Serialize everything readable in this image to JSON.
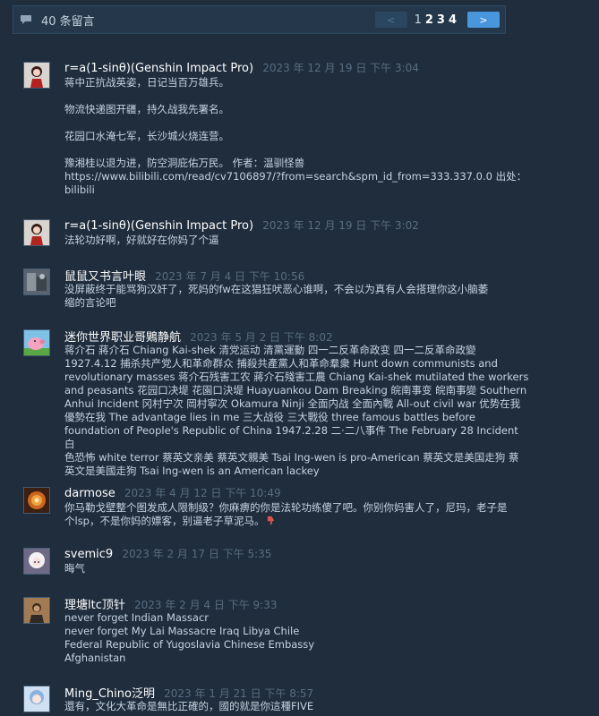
{
  "header": {
    "count_label": "40 条留言",
    "prev_label": "<",
    "next_label": ">",
    "pages": [
      "1",
      "2",
      "3",
      "4"
    ],
    "current_page": "2"
  },
  "comments": [
    {
      "author": "r=a(1-sinθ)(Genshin Impact Pro)",
      "time": "2023 年 12 月 19 日 下午 3:04",
      "avatar_icon": "anime-girl-avatar",
      "lines": [
        "蒋中正抗战英姿，日记当百万雄兵。",
        "",
        "物流快递图开疆，持久战我先署名。",
        "",
        "花园口水淹七军，长沙城火烧连营。",
        "",
        "豫湘桂以退为进，防空洞庇佑万民。 作者：温驯怪兽",
        "https://www.bilibili.com/read/cv7106897/?from=search&spm_id_from=333.337.0.0 出处：",
        "bilibili"
      ]
    },
    {
      "author": "r=a(1-sinθ)(Genshin Impact Pro)",
      "time": "2023 年 12 月 19 日 下午 3:02",
      "avatar_icon": "anime-girl-avatar",
      "lines": [
        "法轮功好啊，好就好在你妈了个逼"
      ]
    },
    {
      "author": "鼠鼠又书言叶眼",
      "time": "2023 年 7 月 4 日 下午 10:56",
      "avatar_icon": "photo-avatar",
      "lines": [
        "没屏蔽终于能骂狗汉奸了，死妈的fw在这猖狂吠恶心谁啊，不会以为真有人会搭理你这小脑萎",
        "缩的言论吧"
      ]
    },
    {
      "author": "迷你世界职业哥鶪静航",
      "time": "2023 年 5 月 2 日 下午 8:02",
      "avatar_icon": "pig-avatar",
      "lines": [
        "蒋介石 蔣介石 Chiang Kai-shek 清党运动 清黨運動 四一二反革命政变 四一二反革命政變",
        "1927.4.12 捕杀共产党人和革命群众 捕殺共產黨人和革命羣衆 Hunt down communists and",
        "revolutionary masses 蒋介石残害工农 蔣介石殘害工農 Chiang Kai-shek mutilated the workers",
        "and peasants 花园口决堤 花園口決堤 Huayuankou Dam Breaking 皖南事变 皖南事變 Southern",
        "Anhui Incident 冈村宁次 岡村寧次 Okamura Ninji 全面内战 全面內戰 All-out civil war 优势在我",
        "優勢在我 The advantage lies in me 三大战役 三大戰役 three famous battles before",
        "foundation of People's Republic of China 1947.2.28 二·二八事件 The February 28 Incident 白",
        "色恐怖 white terror 蔡英文亲美 蔡英文親美 Tsai Ing-wen is pro-American 蔡英文是美国走狗 蔡",
        "英文是美國走狗 Tsai Ing-wen is an American lackey"
      ]
    },
    {
      "author": "darmose",
      "time": "2023 年 4 月 12 日 下午 10:49",
      "avatar_icon": "orange-avatar",
      "lines": [
        "你马勒戈壁整个图发成人限制级？你麻痹的你是法轮功练傻了吧。你别你妈害人了，尼玛，老子是",
        "个lsp，不是你妈的嫖客，别逼老子草泥马。"
      ],
      "has_thumb": true
    },
    {
      "author": "svemic9",
      "time": "2023 年 2 月 17 日 下午 5:35",
      "avatar_icon": "white-hair-avatar",
      "lines": [
        "晦气"
      ]
    },
    {
      "author": "理塘ltc顶针",
      "time": "2023 年 2 月 4 日 下午 9:33",
      "avatar_icon": "person-avatar",
      "lines": [
        "never forget Indian Massacr",
        "never forget My Lai Massacre Iraq Libya Chile",
        "Federal Republic of Yugoslavia Chinese Embassy",
        "Afghanistan"
      ]
    },
    {
      "author": "Ming_Chino泛明",
      "time": "2023 年 1 月 21 日 下午 8:57",
      "avatar_icon": "blue-hair-avatar",
      "lines": [
        "還有，文化大革命是無比正確的，國的就是你這種FIVE"
      ]
    }
  ],
  "colors": {
    "background": "#1f2d3d",
    "header_bg": "#25384b",
    "name": "#ffffff",
    "time": "#596d7f",
    "text": "#c6d4df",
    "next_button": "#4896dc"
  }
}
